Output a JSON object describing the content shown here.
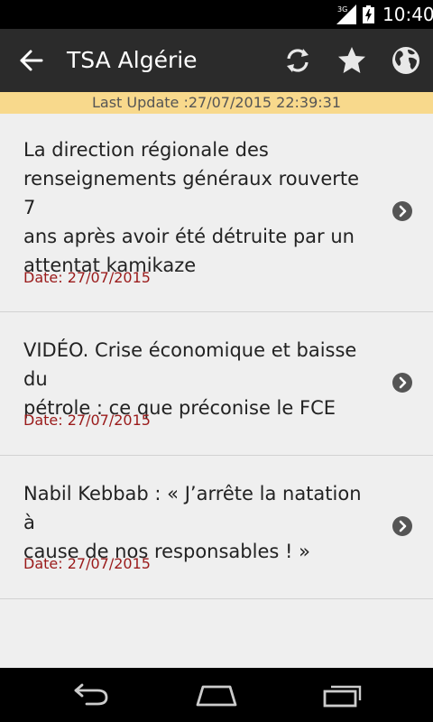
{
  "status_bar": {
    "network": "3G",
    "time": "10:40"
  },
  "app_bar": {
    "title": "TSA Algérie",
    "icons": [
      "back-arrow-icon",
      "refresh-icon",
      "star-icon",
      "globe-icon"
    ]
  },
  "update": {
    "text": "Last Update :27/07/2015 22:39:31"
  },
  "articles": [
    {
      "lines": [
        "La direction régionale des",
        "renseignements généraux rouverte 7",
        "ans après avoir été détruite par un",
        "attentat kamikaze"
      ],
      "date": "Date: 27/07/2015"
    },
    {
      "lines": [
        "VIDÉO. Crise économique et baisse du",
        "pétrole : ce que préconise le FCE"
      ],
      "date": "Date: 27/07/2015"
    },
    {
      "lines": [
        "Nabil Kebbab : « J’arrête la natation à",
        "cause de nos responsables ! »"
      ],
      "date": "Date: 27/07/2015"
    }
  ],
  "colors": {
    "action_bar": "#2b2b2b",
    "update_banner": "#f8d98c",
    "list_bg": "#efefef",
    "date_text": "#9a1a1a"
  }
}
